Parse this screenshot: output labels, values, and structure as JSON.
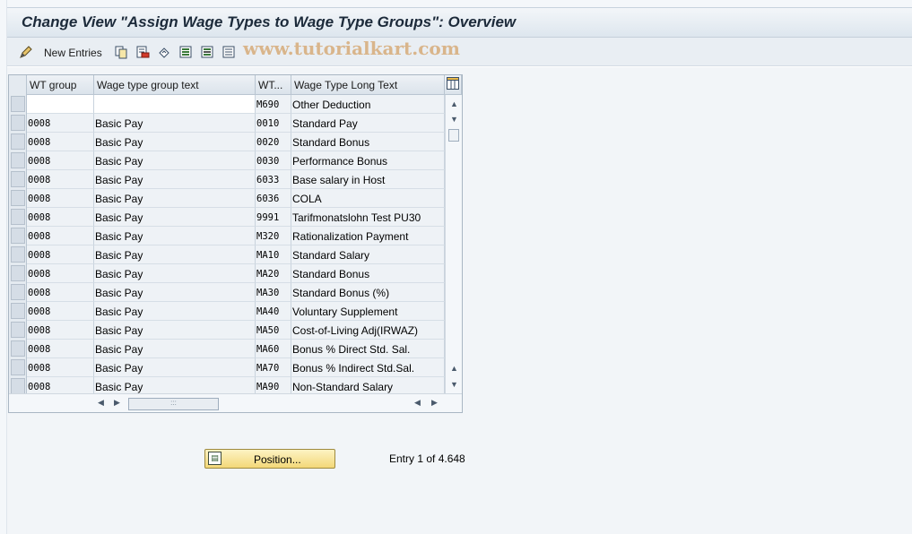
{
  "title": "Change View \"Assign Wage Types to Wage Type Groups\": Overview",
  "toolbar": {
    "new_entries_label": "New Entries",
    "watermark": "www.tutorialkart.com",
    "icons": [
      "edit-pencil-icon",
      "new-entries-icon",
      "copy-icon",
      "delete-icon",
      "undo-icon",
      "select-all-icon",
      "select-block-icon",
      "deselect-all-icon"
    ]
  },
  "table": {
    "columns": [
      "WT group",
      "Wage type group text",
      "WT...",
      "Wage Type Long Text"
    ],
    "rows": [
      {
        "group": "",
        "group_text": "",
        "wt": "M690",
        "long_text": "Other Deduction"
      },
      {
        "group": "0008",
        "group_text": "Basic Pay",
        "wt": "0010",
        "long_text": "Standard Pay"
      },
      {
        "group": "0008",
        "group_text": "Basic Pay",
        "wt": "0020",
        "long_text": "Standard Bonus"
      },
      {
        "group": "0008",
        "group_text": "Basic Pay",
        "wt": "0030",
        "long_text": "Performance Bonus"
      },
      {
        "group": "0008",
        "group_text": "Basic Pay",
        "wt": "6033",
        "long_text": "Base salary in Host"
      },
      {
        "group": "0008",
        "group_text": "Basic Pay",
        "wt": "6036",
        "long_text": "COLA"
      },
      {
        "group": "0008",
        "group_text": "Basic Pay",
        "wt": "9991",
        "long_text": "Tarifmonatslohn Test PU30"
      },
      {
        "group": "0008",
        "group_text": "Basic Pay",
        "wt": "M320",
        "long_text": "Rationalization Payment"
      },
      {
        "group": "0008",
        "group_text": "Basic Pay",
        "wt": "MA10",
        "long_text": "Standard Salary"
      },
      {
        "group": "0008",
        "group_text": "Basic Pay",
        "wt": "MA20",
        "long_text": "Standard Bonus"
      },
      {
        "group": "0008",
        "group_text": "Basic Pay",
        "wt": "MA30",
        "long_text": "Standard Bonus (%)"
      },
      {
        "group": "0008",
        "group_text": "Basic Pay",
        "wt": "MA40",
        "long_text": "Voluntary Supplement"
      },
      {
        "group": "0008",
        "group_text": "Basic Pay",
        "wt": "MA50",
        "long_text": "Cost-of-Living Adj(IRWAZ)"
      },
      {
        "group": "0008",
        "group_text": "Basic Pay",
        "wt": "MA60",
        "long_text": "Bonus % Direct Std. Sal."
      },
      {
        "group": "0008",
        "group_text": "Basic Pay",
        "wt": "MA70",
        "long_text": "Bonus % Indirect Std.Sal."
      },
      {
        "group": "0008",
        "group_text": "Basic Pay",
        "wt": "MA90",
        "long_text": "Non-Standard Salary"
      }
    ]
  },
  "footer": {
    "position_button_label": "Position...",
    "entry_text": "Entry 1 of 4.648"
  },
  "colors": {
    "button_yellow": "#f3d878",
    "header_bg": "#dbe3eb",
    "watermark": "#d6aa78"
  }
}
